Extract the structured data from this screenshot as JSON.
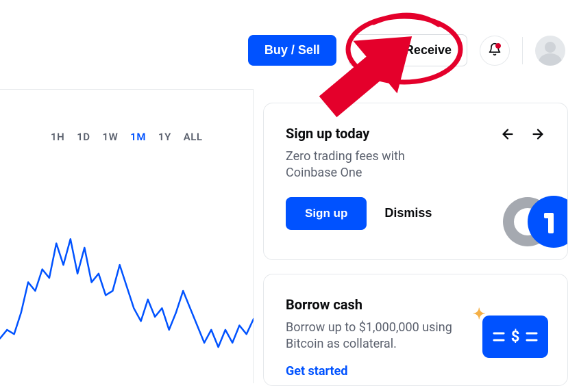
{
  "topbar": {
    "buy_sell_label": "Buy / Sell",
    "send_receive_label": "Send / Receive"
  },
  "chart": {
    "timeframes": [
      "1H",
      "1D",
      "1W",
      "1M",
      "1Y",
      "ALL"
    ],
    "active_timeframe": "1M"
  },
  "promo_card": {
    "title": "Sign up today",
    "subtitle": "Zero trading fees with Coinbase One",
    "primary_label": "Sign up",
    "dismiss_label": "Dismiss"
  },
  "borrow_card": {
    "title": "Borrow cash",
    "subtitle": "Borrow up to $1,000,000 using Bitcoin as collateral.",
    "cta_label": "Get started"
  },
  "chart_data": {
    "type": "line",
    "title": "",
    "xlabel": "",
    "ylabel": "",
    "timeframe": "1M",
    "x": [
      0,
      1,
      2,
      3,
      4,
      5,
      6,
      7,
      8,
      9,
      10,
      11,
      12,
      13,
      14,
      15,
      16,
      17,
      18,
      19,
      20,
      21,
      22,
      23,
      24,
      25,
      26,
      27,
      28,
      29,
      30,
      31,
      32,
      33,
      34,
      35,
      36
    ],
    "values": [
      16,
      20,
      18,
      28,
      42,
      38,
      48,
      44,
      60,
      50,
      62,
      46,
      58,
      42,
      46,
      36,
      38,
      50,
      40,
      30,
      24,
      34,
      26,
      30,
      20,
      28,
      38,
      30,
      22,
      14,
      20,
      12,
      20,
      14,
      22,
      18,
      25
    ],
    "ylim": [
      0,
      70
    ],
    "note": "Values are relative (no axis labels visible in screenshot)"
  }
}
